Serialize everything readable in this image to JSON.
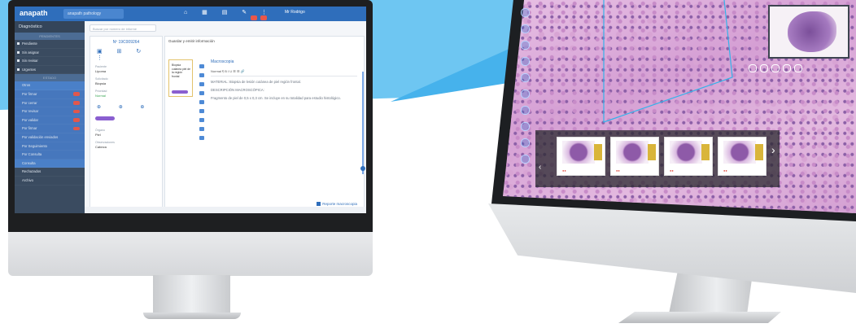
{
  "app": {
    "logo": "anapath",
    "tab_label": "anapath pathology",
    "user": "Mr Rodrigo"
  },
  "sidebar": {
    "title": "Diagnóstico",
    "sections": [
      "PENDIENTES",
      "ESTADO"
    ],
    "items": [
      "Pendiente",
      "Sin asignar",
      "Sin revisar",
      "Urgentes",
      "Otros",
      "Por firmar",
      "Por cerrar",
      "Por revisar",
      "Por validar",
      "Por firmar",
      "Por validación enviados",
      "Por Seguimiento",
      "Por Consulta",
      "Consulta",
      "Rechazados",
      "Archivo"
    ]
  },
  "search": {
    "placeholder": "Buscar por número de informe"
  },
  "case": {
    "number": "Nº 19C009264",
    "labels": [
      "Paciente",
      "Solicitado",
      "Prioridad",
      "Órgano",
      "Observaciones"
    ],
    "values": [
      "Lipoma",
      "Biopsia",
      "Normal",
      "Piel",
      "Cabeza"
    ]
  },
  "editor": {
    "crumb": "Guardar y emitir información",
    "title": "Macroscopia",
    "card_text": "Biopsia cutánea piel de la región frontal",
    "toolbar": "Normal  ¶  B  I  U  ☰  ☰  🔗",
    "paragraphs": [
      "MATERIAL: Biopsia de lesión cutánea de piel región frontal.",
      "DESCRIPCIÓN MACROSCÓPICA:",
      "Fragmento de piel de 0,5 x 0,3 cm. Se incluye en su totalidad para estudio histológico."
    ],
    "checkbox_label": "Reporte macroscopia"
  },
  "colors": {
    "accent": "#2f6ebb",
    "sidebar": "#3a4b60",
    "alert": "#e2574c",
    "tag": "#8a5fd0"
  }
}
